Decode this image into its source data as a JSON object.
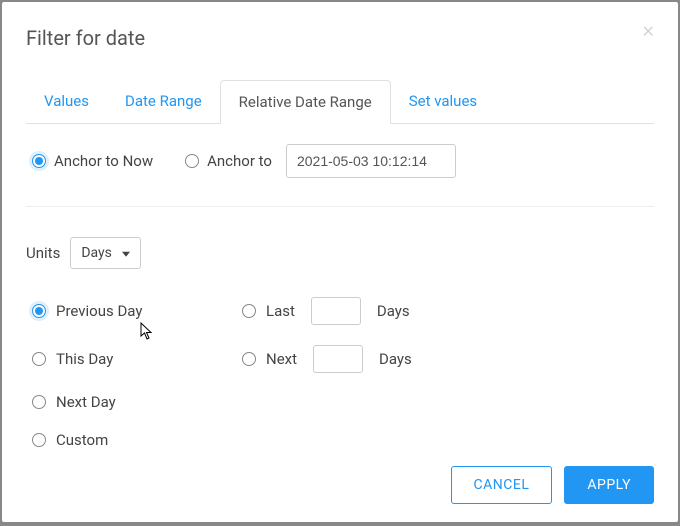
{
  "modal": {
    "title": "Filter for date"
  },
  "tabs": {
    "values": "Values",
    "date_range": "Date Range",
    "relative": "Relative Date Range",
    "set_values": "Set values"
  },
  "anchor": {
    "now_label": "Anchor to Now",
    "to_label": "Anchor to",
    "datetime": "2021-05-03 10:12:14"
  },
  "units": {
    "label": "Units",
    "selected": "Days"
  },
  "options": {
    "previous": "Previous Day",
    "this": "This Day",
    "next": "Next Day",
    "custom": "Custom",
    "last_prefix": "Last",
    "last_suffix": "Days",
    "next_n_prefix": "Next",
    "next_n_suffix": "Days"
  },
  "footer": {
    "cancel": "CANCEL",
    "apply": "APPLY"
  }
}
